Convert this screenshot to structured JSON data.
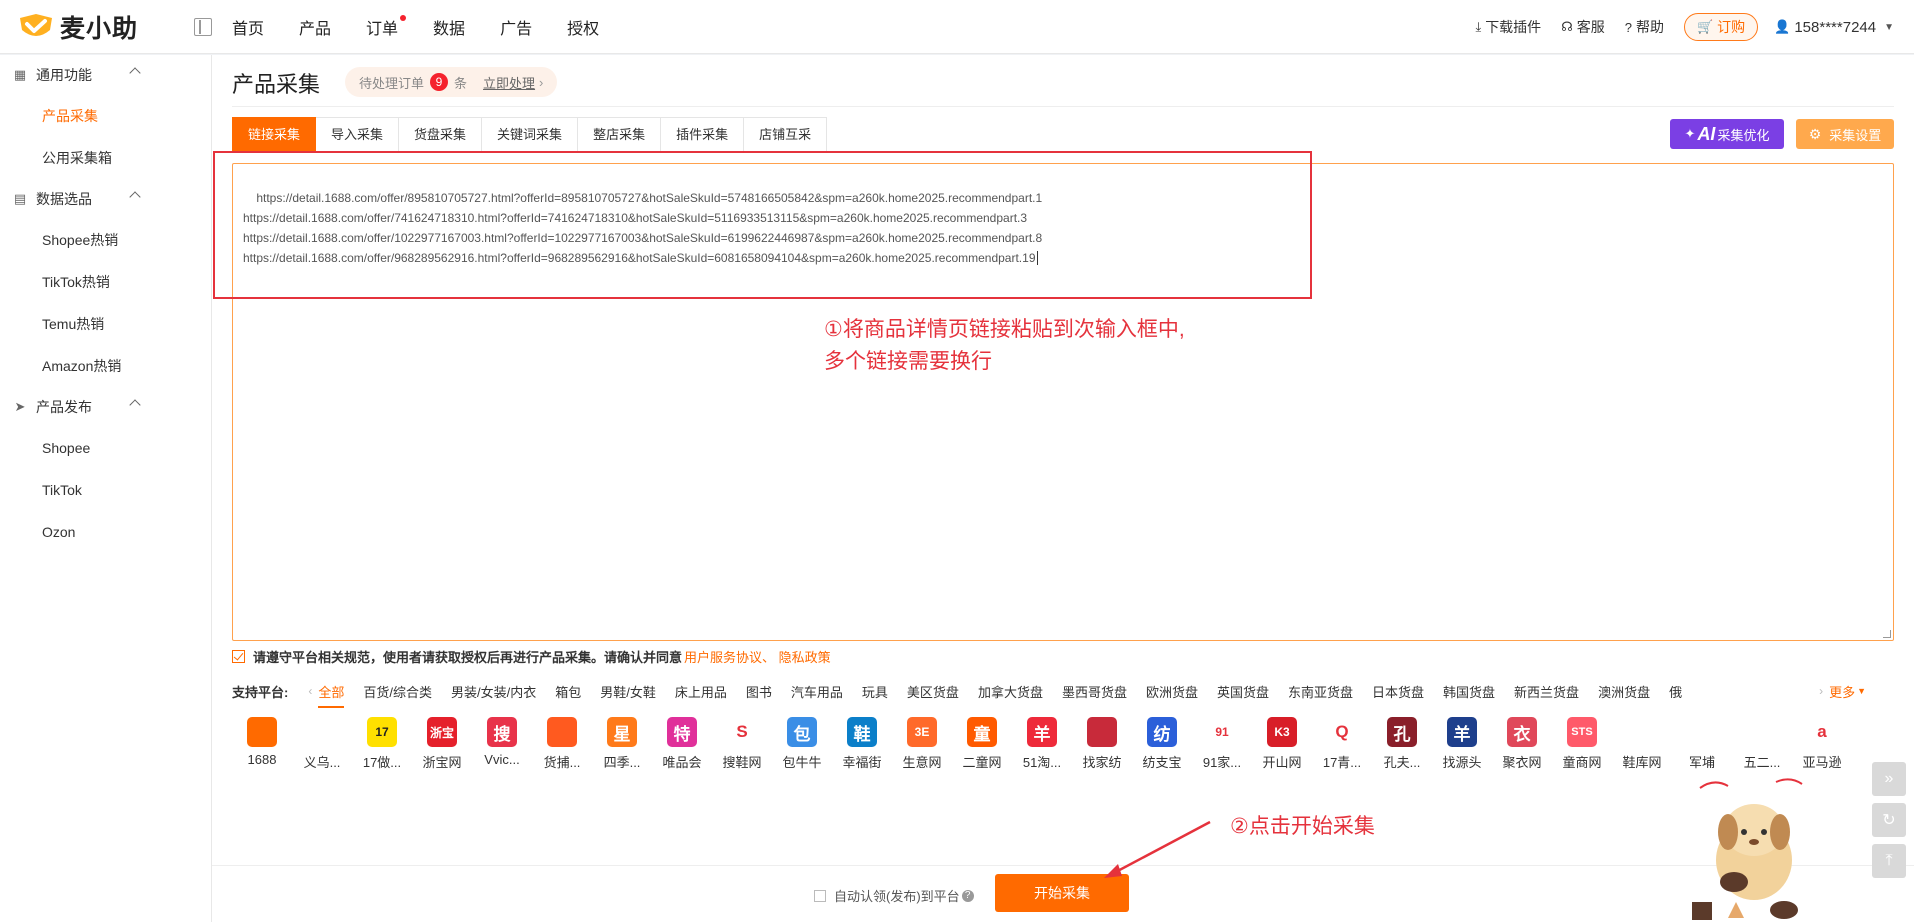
{
  "app": {
    "name": "麦小助",
    "brand_color": "#ff6a00"
  },
  "nav": [
    {
      "label": "首页",
      "dot": false
    },
    {
      "label": "产品",
      "dot": false
    },
    {
      "label": "订单",
      "dot": true
    },
    {
      "label": "数据",
      "dot": false
    },
    {
      "label": "广告",
      "dot": false
    },
    {
      "label": "授权",
      "dot": false
    }
  ],
  "topright": {
    "download": "下载插件",
    "service": "客服",
    "help": "帮助",
    "order": "订购",
    "user": "158****7244"
  },
  "sidebar": {
    "groups": [
      {
        "title": "通用功能",
        "icon": "grid-icon",
        "items": [
          {
            "label": "产品采集",
            "active": true
          },
          {
            "label": "公用采集箱",
            "active": false
          }
        ]
      },
      {
        "title": "数据选品",
        "icon": "chart-icon",
        "items": [
          {
            "label": "Shopee热销"
          },
          {
            "label": "TikTok热销"
          },
          {
            "label": "Temu热销"
          },
          {
            "label": "Amazon热销"
          }
        ]
      },
      {
        "title": "产品发布",
        "icon": "send-icon",
        "items": [
          {
            "label": "Shopee"
          },
          {
            "label": "TikTok"
          },
          {
            "label": "Ozon"
          }
        ]
      }
    ]
  },
  "page": {
    "title": "产品采集",
    "pending": {
      "prefix": "待处理订单",
      "count": "9",
      "suffix": "条",
      "action": "立即处理"
    }
  },
  "tabs": [
    "链接采集",
    "导入采集",
    "货盘采集",
    "关键词采集",
    "整店采集",
    "插件采集",
    "店铺互采"
  ],
  "active_tab": "链接采集",
  "buttons": {
    "ai_prefix": "AI",
    "ai_label": "采集优化",
    "settings": "采集设置",
    "start": "开始采集"
  },
  "links": "https://detail.1688.com/offer/895810705727.html?offerId=895810705727&hotSaleSkuId=5748166505842&spm=a260k.home2025.recommendpart.1\nhttps://detail.1688.com/offer/741624718310.html?offerId=741624718310&hotSaleSkuId=5116933513115&spm=a260k.home2025.recommendpart.3\nhttps://detail.1688.com/offer/1022977167003.html?offerId=1022977167003&hotSaleSkuId=6199622446987&spm=a260k.home2025.recommendpart.8\nhttps://detail.1688.com/offer/968289562916.html?offerId=968289562916&hotSaleSkuId=6081658094104&spm=a260k.home2025.recommendpart.19",
  "annotations": {
    "note1_line1": "①将商品详情页链接粘贴到次输入框中,",
    "note1_line2": "多个链接需要换行",
    "note2": "②点击开始采集"
  },
  "agreement": {
    "text": "请遵守平台相关规范，使用者请获取授权后再进行产品采集。请确认并同意",
    "link": "用户服务协议、 隐私政策"
  },
  "platforms": {
    "label": "支持平台:",
    "categories": [
      "全部",
      "百货/综合类",
      "男装/女装/内衣",
      "箱包",
      "男鞋/女鞋",
      "床上用品",
      "图书",
      "汽车用品",
      "玩具",
      "美区货盘",
      "加拿大货盘",
      "墨西哥货盘",
      "欧洲货盘",
      "英国货盘",
      "东南亚货盘",
      "日本货盘",
      "韩国货盘",
      "新西兰货盘",
      "澳洲货盘",
      "俄"
    ],
    "more": "更多",
    "icons": [
      {
        "name": "1688",
        "glyph": "",
        "color": "#ff6a00"
      },
      {
        "name": "义乌...",
        "glyph": "",
        "color": "#ffffff"
      },
      {
        "name": "17做...",
        "glyph": "17",
        "color": "#ffe000"
      },
      {
        "name": "浙宝网",
        "glyph": "浙宝",
        "color": "#e5202b"
      },
      {
        "name": "Vvic...",
        "glyph": "搜",
        "color": "#e8334a"
      },
      {
        "name": "货捕...",
        "glyph": "",
        "color": "#ff5a1f"
      },
      {
        "name": "四季...",
        "glyph": "星",
        "color": "#ff7a1a"
      },
      {
        "name": "唯品会",
        "glyph": "特",
        "color": "#e0309a"
      },
      {
        "name": "搜鞋网",
        "glyph": "S",
        "color": "#ffffff"
      },
      {
        "name": "包牛牛",
        "glyph": "包",
        "color": "#3a8ee6"
      },
      {
        "name": "幸福街",
        "glyph": "鞋",
        "color": "#0b7fc9"
      },
      {
        "name": "生意网",
        "glyph": "3E",
        "color": "#ff6a2a"
      },
      {
        "name": "二童网",
        "glyph": "童",
        "color": "#ff5a00"
      },
      {
        "name": "51淘...",
        "glyph": "羊",
        "color": "#ee2a3a"
      },
      {
        "name": "找家纺",
        "glyph": "",
        "color": "#c82a3a"
      },
      {
        "name": "纺支宝",
        "glyph": "纺",
        "color": "#2b5fd9"
      },
      {
        "name": "91家...",
        "glyph": "91",
        "color": "#ffffff"
      },
      {
        "name": "开山网",
        "glyph": "K3",
        "color": "#d81e28"
      },
      {
        "name": "17青...",
        "glyph": "Q",
        "color": "#ffffff"
      },
      {
        "name": "孔夫...",
        "glyph": "孔",
        "color": "#8a1f2a"
      },
      {
        "name": "找源头",
        "glyph": "羊",
        "color": "#1e3f8c"
      },
      {
        "name": "聚衣网",
        "glyph": "衣",
        "color": "#e0485a"
      },
      {
        "name": "童商网",
        "glyph": "STS",
        "color": "#ff5a6a"
      },
      {
        "name": "鞋库网",
        "glyph": "",
        "color": "#ffffff"
      },
      {
        "name": "军埔",
        "glyph": "",
        "color": "#ffffff"
      },
      {
        "name": "五二...",
        "glyph": "",
        "color": "#ffffff"
      },
      {
        "name": "亚马逊",
        "glyph": "a",
        "color": "#ffffff"
      }
    ]
  },
  "bottom": {
    "auto_label": "自动认领(发布)到平台"
  }
}
